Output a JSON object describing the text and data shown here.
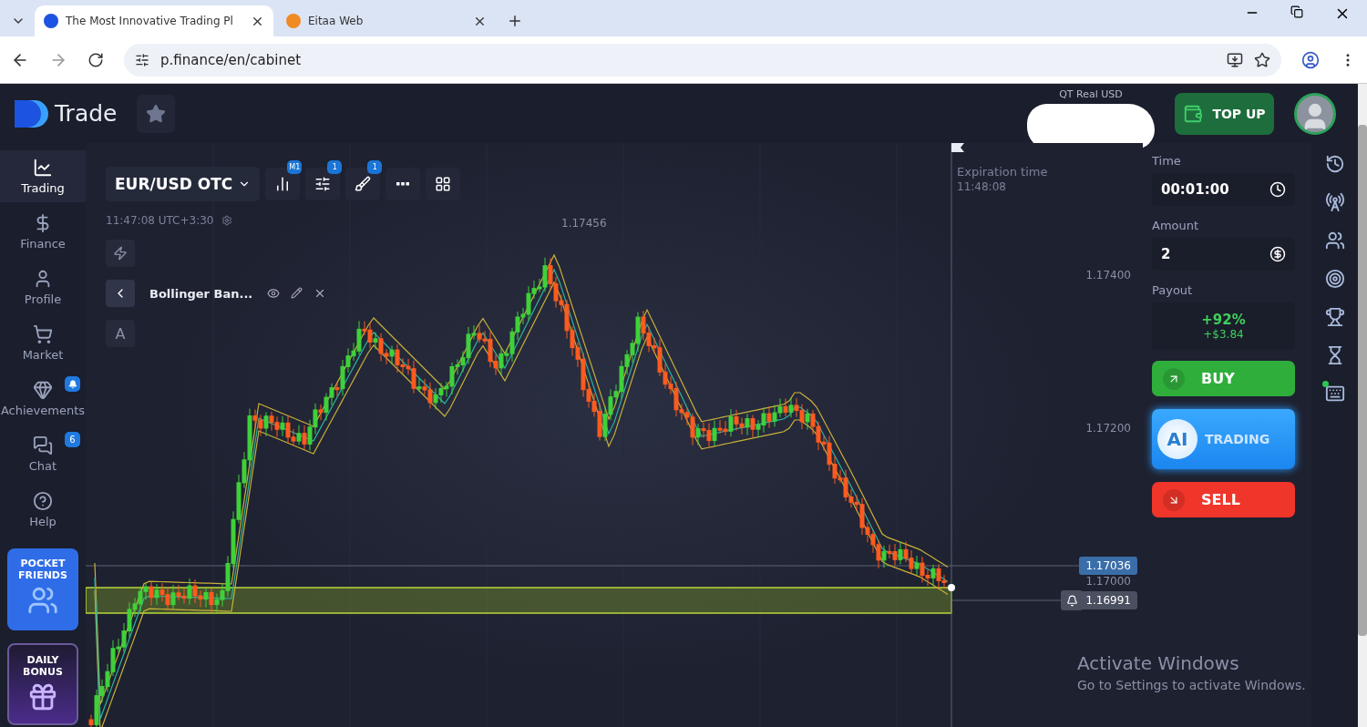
{
  "browser": {
    "tabs": [
      {
        "title": "The Most Innovative Trading Pl",
        "selected": true
      },
      {
        "title": "Eitaa Web",
        "selected": false
      }
    ],
    "address": "p.finance/en/cabinet"
  },
  "header": {
    "logo_text": "Trade",
    "account_label": "QT Real  USD",
    "top_up": "TOP UP"
  },
  "sidebar": {
    "items": [
      {
        "label": "Trading",
        "selected": true,
        "kind": "trading"
      },
      {
        "label": "Finance",
        "selected": false,
        "kind": "finance"
      },
      {
        "label": "Profile",
        "selected": false,
        "kind": "profile"
      },
      {
        "label": "Market",
        "selected": false,
        "kind": "market"
      },
      {
        "label": "Achievements",
        "selected": false,
        "kind": "achievements",
        "alert": true
      },
      {
        "label": "Chat",
        "selected": false,
        "kind": "chat",
        "badge": "6"
      },
      {
        "label": "Help",
        "selected": false,
        "kind": "help"
      }
    ],
    "promos": [
      {
        "kind": "friends",
        "title": "POCKET FRIENDS"
      },
      {
        "kind": "bonus",
        "title": "DAILY BONUS"
      }
    ]
  },
  "chart": {
    "asset": "EUR/USD OTC",
    "toolbar": [
      {
        "kind": "chart-type",
        "badge": "M1"
      },
      {
        "kind": "indicators",
        "badge": "1"
      },
      {
        "kind": "drawings",
        "badge": "1"
      },
      {
        "kind": "more"
      },
      {
        "kind": "layout"
      }
    ],
    "clock": "11:47:08 UTC+3:30",
    "indicator": "Bollinger Ban...",
    "text_tool": "A",
    "high_label": "1.17456",
    "expiration": {
      "label": "Expiration time",
      "time": "11:48:08"
    },
    "axis_labels": [
      "1.17400",
      "1.17200",
      "1.17000"
    ],
    "current_price": "1.17036",
    "alert_price": "1.16991"
  },
  "trade_panel": {
    "time_label": "Time",
    "time_value": "00:01:00",
    "amount_label": "Amount",
    "amount_value": "2",
    "payout_label": "Payout",
    "payout_percent": "+92%",
    "payout_profit": "+$3.84",
    "buy": "BUY",
    "ai_badge": "AI",
    "ai_label": "TRADING",
    "sell": "SELL"
  },
  "right_tools": [
    {
      "kind": "history"
    },
    {
      "kind": "signals"
    },
    {
      "kind": "social"
    },
    {
      "kind": "target"
    },
    {
      "kind": "trophy"
    },
    {
      "kind": "hourglass"
    },
    {
      "kind": "keyboard",
      "dot": true
    }
  ],
  "os_notice": {
    "title": "Activate Windows",
    "subtitle": "Go to Settings to activate Windows."
  }
}
